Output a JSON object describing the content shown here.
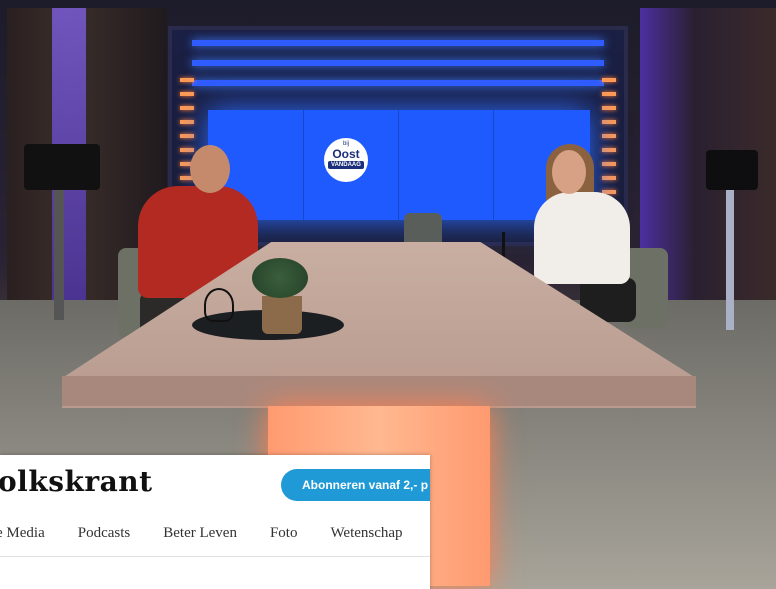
{
  "studio": {
    "logo_top": "bij",
    "logo_main": "Oost",
    "logo_bottom": "VANDAAG"
  },
  "article_card": {
    "brand": "olkskrant",
    "subscribe_label": "Abonneren vanaf 2,- p",
    "nav_items": [
      "e Media",
      "Podcasts",
      "Beter Leven",
      "Foto",
      "Wetenschap"
    ]
  },
  "colors": {
    "subscribe_button": "#1f9ad6",
    "screen_blue": "#1f5aff"
  }
}
